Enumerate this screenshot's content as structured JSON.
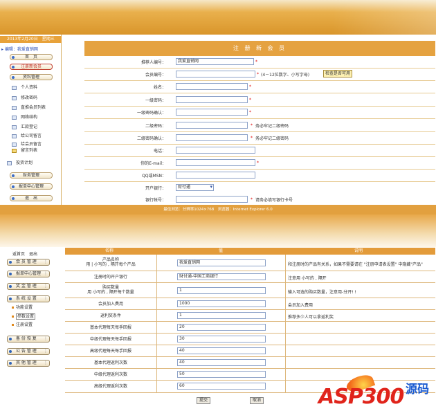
{
  "top": {
    "date": "2013年2月20日　星期三",
    "crumb": "编辑：我爱直销网",
    "menu": {
      "home": "首　页",
      "reg": "注册新会员",
      "profile": "资料管理",
      "finance": "财务管理",
      "orders": "报单中心管理",
      "logout": "退　出"
    },
    "sub_items": [
      "个人资料",
      "修改密码",
      "直推会员列表",
      "网络结构",
      "汇款登记",
      "给公司留言",
      "给会员留言",
      "留言列表",
      "投资计划"
    ],
    "form_title": "注 册 新 会 员",
    "fields": {
      "referrer": {
        "label": "推荐人编号：",
        "value": "我爱直销网"
      },
      "member_no": {
        "label": "会员编号：",
        "hint": "(4－12位数字、小写字母)",
        "check": "检查是否可用"
      },
      "name": {
        "label": "姓名："
      },
      "pwd1": {
        "label": "一级密码："
      },
      "pwd1c": {
        "label": "一级密码确认："
      },
      "pwd2": {
        "label": "二级密码：",
        "hint": "务必牢记二级密码"
      },
      "pwd2c": {
        "label": "二级密码确认：",
        "hint": "务必牢记二级密码"
      },
      "phone": {
        "label": "电话："
      },
      "email": {
        "label": "你的E-mail："
      },
      "qq": {
        "label": "QQ或MSN："
      },
      "bank": {
        "label": "开户银行：",
        "value": "财付通"
      },
      "account": {
        "label": "银行帐号：",
        "hint": "请务必填写银行卡号"
      }
    },
    "footer": "最佳浏览：分辨率1024×768　浏览器：Internet Explorer 6.0"
  },
  "bottom": {
    "home_link": "返首页　退出",
    "side": {
      "members": "会 员 管 理",
      "orders": "报单中心管理",
      "money": "奖 金 管 理",
      "system": "系 统 设 置",
      "backup": "备 份 恢 复",
      "notice": "公 告 管 理",
      "other": "其 他 管 理"
    },
    "system_subs": [
      "功能设置",
      "参数设置",
      "注册设置"
    ],
    "table": {
      "head": {
        "name": "名称",
        "value": "值",
        "desc": "说明"
      },
      "rows": [
        {
          "name": "产品名称\n用 | 小写的 , 隔开每个产品",
          "value": "我爱直销网",
          "desc": "和注册时的产品有关系，如果不需要请在 \"注册申请表设置\" 中隐藏\"产品\""
        },
        {
          "name": "注册时的开户银行",
          "value": "财付通-中国工商银行",
          "desc": "注意用 小写的 , 隔开"
        },
        {
          "name": "购买数量\n用 小写的 , 隔开每个数量",
          "value": "1",
          "desc": "输入可选的购买数量，注意用-分开! !"
        },
        {
          "name": "会员加入费用",
          "value": "1000",
          "desc": "会员加入费用"
        },
        {
          "name": "返利奖条件",
          "value": "1",
          "desc": "推荐多少人可以拿返利奖"
        },
        {
          "name": "基本代理每天每手回报",
          "value": "20",
          "desc": ""
        },
        {
          "name": "中级代理每天每手回报",
          "value": "30",
          "desc": ""
        },
        {
          "name": "高级代理每天每手回报",
          "value": "40",
          "desc": ""
        },
        {
          "name": "基本代理返利次数",
          "value": "40",
          "desc": ""
        },
        {
          "name": "中级代理返利次数",
          "value": "50",
          "desc": ""
        },
        {
          "name": "高级代理返利次数",
          "value": "60",
          "desc": ""
        }
      ]
    },
    "submit": "提交",
    "cancel": "取消"
  },
  "logo": {
    "text": "ASP300",
    "cn": "源码"
  },
  "colors": {
    "accent": "#e39b3a",
    "header": "#e5a240",
    "required": "#dd0000"
  }
}
